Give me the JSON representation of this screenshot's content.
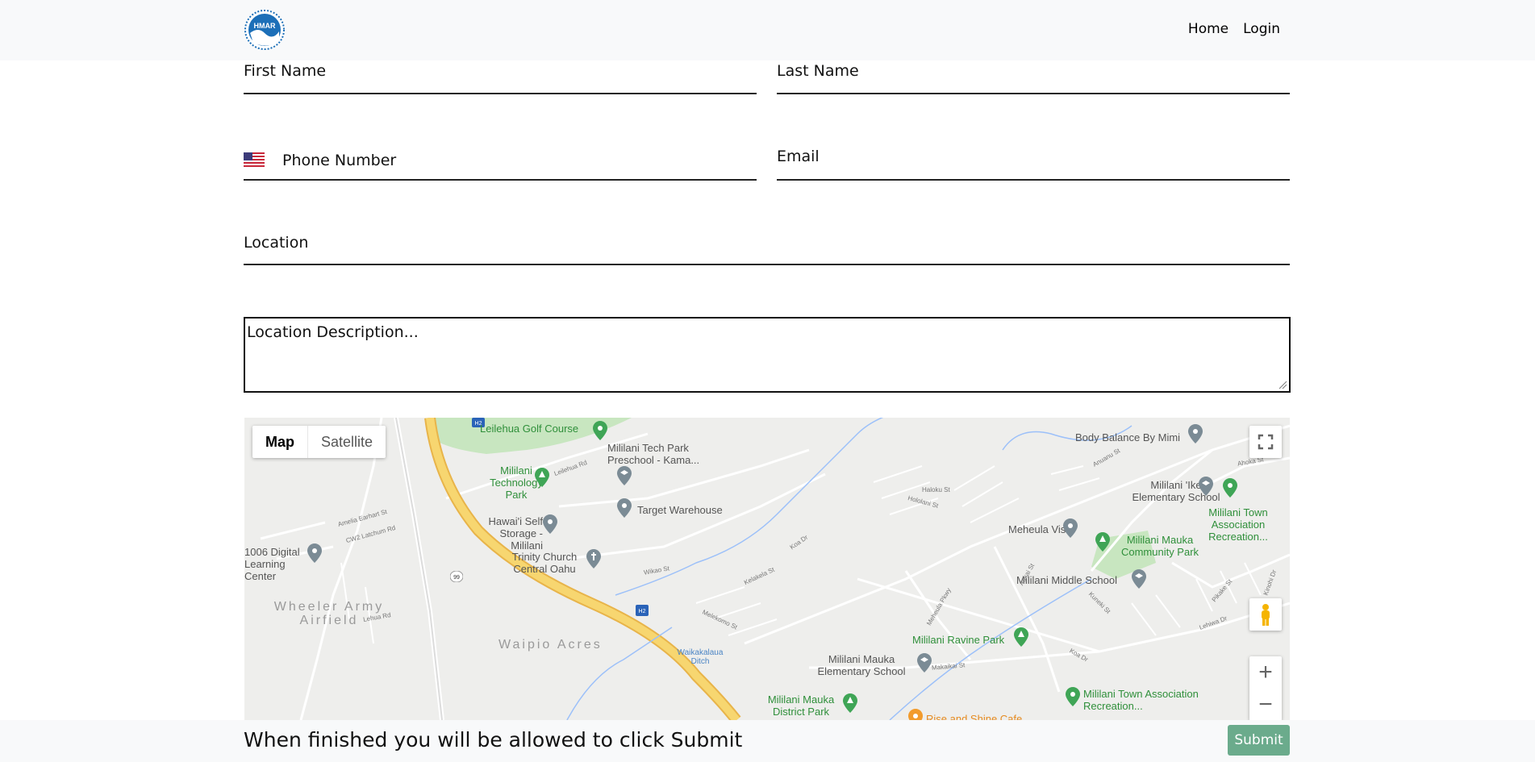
{
  "navbar": {
    "logo_text": "HMAR",
    "links": [
      "Home",
      "Login"
    ]
  },
  "form": {
    "first_name": "First Name",
    "last_name": "Last Name",
    "phone": "Phone Number",
    "email": "Email",
    "location": "Location",
    "location_description": "Location Description..."
  },
  "map": {
    "type_map": "Map",
    "type_satellite": "Satellite",
    "zoom_in": "+",
    "zoom_out": "−",
    "highway_h2": "H2",
    "route_99": "99",
    "places": {
      "leilehua_golf": "Leilehua Golf Course",
      "tech_park": "Mililani Technology Park",
      "tech_preschool": "Mililani Tech Park Preschool - Kama...",
      "target": "Target Warehouse",
      "self_storage": "Hawai'i Self Storage - Mililani",
      "trinity": "Trinity Church Central Oahu",
      "digital_learning": "1006 Digital Learning Center",
      "wheeler": "Wheeler Army Airfield",
      "waipio": "Waipio Acres",
      "ditch": "Waikakalaua Ditch",
      "body_balance": "Body Balance By Mimi",
      "ike_school": "Mililani 'Ike Elementary School",
      "town_assoc_1": "Mililani Town Association Recreation...",
      "meheula": "Meheula Vista",
      "mauka_park": "Mililani Mauka Community Park",
      "middle_school": "Mililani Middle School",
      "ravine_park": "Mililani Ravine Park",
      "mauka_elem": "Mililani Mauka Elementary School",
      "mauka_district": "Mililani Mauka District Park",
      "town_assoc_2": "Mililani Town Association Recreation...",
      "rise_shine": "Rise and Shine Cafe"
    },
    "streets": {
      "s1": "Leilehua Rd",
      "s2": "Amelia Earhart St",
      "s3": "CW2 Latchum Rd",
      "s4": "Wikao St",
      "s5": "Kelakela St",
      "s6": "Meheula Pkwy",
      "s7": "Kuneki St",
      "s8": "Lehiwa Dr",
      "s9": "Makaikai St",
      "s10": "Melekomo St",
      "s11": "Lehua Rd",
      "s12": "Koa Dr",
      "s13": "Hololani St",
      "s14": "Haloku St",
      "s15": "Anuanu St",
      "s16": "Ahoka St",
      "s17": "Koa Dr",
      "s18": "Aukai St",
      "s19": "Kinohi Dr",
      "s20": "Pikake St"
    }
  },
  "footer": {
    "message": "When finished you will be allowed to click Submit",
    "submit": "Submit"
  },
  "colors": {
    "submit_bg": "#6bab8c",
    "navbar_bg": "#f8f9fa",
    "highway": "#f7d670",
    "park": "#c8e6c0"
  }
}
